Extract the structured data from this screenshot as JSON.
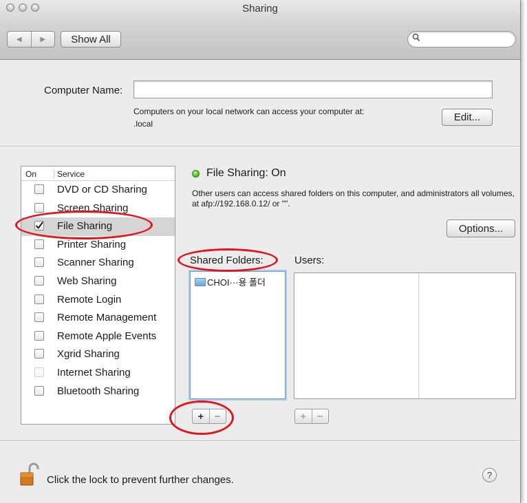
{
  "window": {
    "title": "Sharing"
  },
  "toolbar": {
    "back_glyph": "◀",
    "forward_glyph": "▶",
    "show_all_label": "Show All",
    "search_placeholder": ""
  },
  "computer_name": {
    "label": "Computer Name:",
    "value": "",
    "note_line1": "Computers on your local network can access your computer at:",
    "note_line2": ".local",
    "edit_label": "Edit..."
  },
  "services": {
    "header_on": "On",
    "header_service": "Service",
    "items": [
      {
        "label": "DVD or CD Sharing",
        "checked": false,
        "enabled": true,
        "selected": false
      },
      {
        "label": "Screen Sharing",
        "checked": false,
        "enabled": true,
        "selected": false
      },
      {
        "label": "File Sharing",
        "checked": true,
        "enabled": true,
        "selected": true
      },
      {
        "label": "Printer Sharing",
        "checked": false,
        "enabled": true,
        "selected": false
      },
      {
        "label": "Scanner Sharing",
        "checked": false,
        "enabled": true,
        "selected": false
      },
      {
        "label": "Web Sharing",
        "checked": false,
        "enabled": true,
        "selected": false
      },
      {
        "label": "Remote Login",
        "checked": false,
        "enabled": true,
        "selected": false
      },
      {
        "label": "Remote Management",
        "checked": false,
        "enabled": true,
        "selected": false
      },
      {
        "label": "Remote Apple Events",
        "checked": false,
        "enabled": true,
        "selected": false
      },
      {
        "label": "Xgrid Sharing",
        "checked": false,
        "enabled": true,
        "selected": false
      },
      {
        "label": "Internet Sharing",
        "checked": false,
        "enabled": false,
        "selected": false
      },
      {
        "label": "Bluetooth Sharing",
        "checked": false,
        "enabled": true,
        "selected": false
      }
    ]
  },
  "file_sharing": {
    "status": "File Sharing: On",
    "status_color": "#4fbf2b",
    "description": "Other users can access shared folders on this computer, and administrators all volumes, at afp://192.168.0.12/ or \"\".",
    "options_label": "Options...",
    "shared_folders_label": "Shared Folders:",
    "users_label": "Users:",
    "shared_folders": [
      "CHOI···용 폴더"
    ],
    "add_glyph": "+",
    "remove_glyph": "−"
  },
  "footer": {
    "lock_text": "Click the lock to prevent further changes.",
    "help_glyph": "?"
  },
  "annotation_color": "#e0161c"
}
